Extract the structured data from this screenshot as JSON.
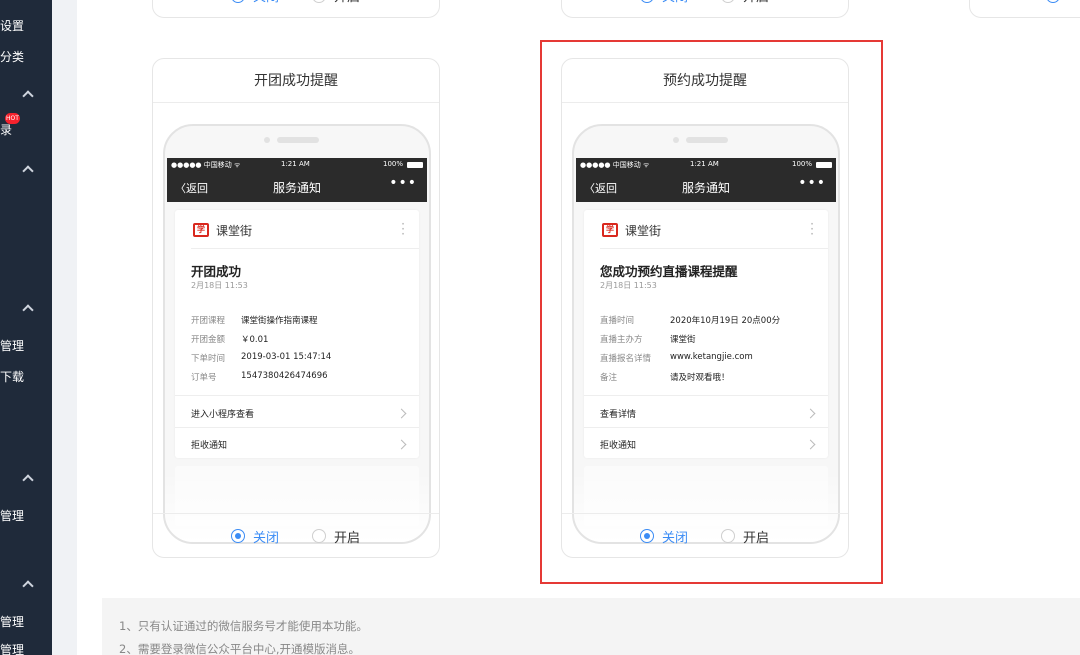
{
  "sidebar": {
    "items": [
      "设置",
      "分类",
      "录",
      "管理",
      "下载",
      "管理",
      "管理",
      "管理"
    ],
    "badge": "HOT"
  },
  "top_cards": [
    {
      "off": "关闭",
      "on": "开启"
    },
    {
      "off": "关闭",
      "on": "开启"
    }
  ],
  "cards": [
    {
      "title": "开团成功提醒",
      "phone": {
        "carrier": "●●●●● 中国移动 ᯤ",
        "time": "1:21 AM",
        "battery": "100%",
        "back": "〈返回",
        "nav_title": "服务通知",
        "more": "•••"
      },
      "message": {
        "brand": "课堂街",
        "title": "开团成功",
        "date": "2月18日 11:53",
        "rows": [
          {
            "label": "开团课程",
            "value": "课堂街操作指南课程"
          },
          {
            "label": "开团金额",
            "value": "￥0.01"
          },
          {
            "label": "下单时间",
            "value": "2019-03-01 15:47:14"
          },
          {
            "label": "订单号",
            "value": "1547380426474696"
          }
        ],
        "links": [
          "进入小程序查看",
          "拒收通知"
        ]
      },
      "radio": {
        "off": "关闭",
        "on": "开启",
        "selected": "off"
      }
    },
    {
      "title": "预约成功提醒",
      "phone": {
        "carrier": "●●●●● 中国移动 ᯤ",
        "time": "1:21 AM",
        "battery": "100%",
        "back": "〈返回",
        "nav_title": "服务通知",
        "more": "•••"
      },
      "message": {
        "brand": "课堂街",
        "title": "您成功预约直播课程提醒",
        "date": "2月18日 11:53",
        "rows": [
          {
            "label": "直播时间",
            "value": "2020年10月19日 20点00分"
          },
          {
            "label": "直播主办方",
            "value": "课堂街"
          },
          {
            "label": "直播报名详情",
            "value": "www.ketangjie.com"
          },
          {
            "label": "备注",
            "value": "请及时观看哦！"
          }
        ],
        "links": [
          "查看详情",
          "拒收通知"
        ]
      },
      "radio": {
        "off": "关闭",
        "on": "开启",
        "selected": "off"
      }
    }
  ],
  "notes": [
    "1、只有认证通过的微信服务号才能使用本功能。",
    "2、需要登录微信公众平台中心,开通模版消息。"
  ],
  "colors": {
    "sidebar": "#1f2a3a",
    "accent": "#3b8cf5",
    "highlight": "#e53935",
    "brand": "#d9281e"
  }
}
